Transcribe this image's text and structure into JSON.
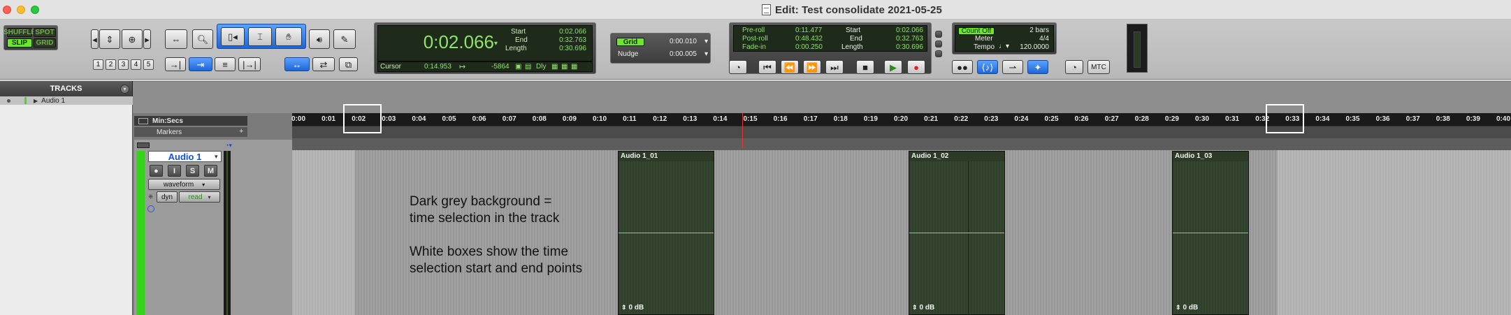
{
  "window": {
    "title": "Edit: Test consolidate 2021-05-25"
  },
  "toolbar": {
    "modes": {
      "shuffle": "SHUFFLE",
      "spot": "SPOT",
      "slip": "SLIP",
      "grid": "GRID"
    },
    "zoom_presets": [
      "1",
      "2",
      "3",
      "4",
      "5"
    ],
    "main_counter": "0:02.066",
    "selection": {
      "start_label": "Start",
      "start": "0:02.066",
      "end_label": "End",
      "end": "0:32.763",
      "length_label": "Length",
      "length": "0:30.696"
    },
    "cursor": {
      "label": "Cursor",
      "time": "0:14.953",
      "sample": "-5864",
      "dly_label": "Dly"
    },
    "grid": {
      "label": "Grid",
      "value": "0:00.010"
    },
    "nudge": {
      "label": "Nudge",
      "value": "0:00.005"
    },
    "transport": {
      "preroll_label": "Pre-roll",
      "preroll": "0:11.477",
      "postroll_label": "Post-roll",
      "postroll": "0:48.432",
      "fadein_label": "Fade-in",
      "fadein": "0:00.250",
      "start_label": "Start",
      "start": "0:02.066",
      "end_label": "End",
      "end": "0:32.763",
      "length_label": "Length",
      "length": "0:30.696"
    },
    "countoff": {
      "label": "Count Off",
      "value": "2 bars",
      "meter_label": "Meter",
      "meter": "4/4",
      "tempo_label": "Tempo",
      "tempo": "120.0000"
    },
    "mtc_label": "MTC"
  },
  "tracks_panel": {
    "title": "TRACKS",
    "items": [
      {
        "name": "Audio 1"
      }
    ]
  },
  "rulers": {
    "minsecs": "Min:Secs",
    "markers": "Markers"
  },
  "timeline_ticks": [
    "0:00",
    "0:01",
    "0:02",
    "0:03",
    "0:04",
    "0:05",
    "0:06",
    "0:07",
    "0:08",
    "0:09",
    "0:10",
    "0:11",
    "0:12",
    "0:13",
    "0:14",
    "0:15",
    "0:16",
    "0:17",
    "0:18",
    "0:19",
    "0:20",
    "0:21",
    "0:22",
    "0:23",
    "0:24",
    "0:25",
    "0:26",
    "0:27",
    "0:28",
    "0:29",
    "0:30",
    "0:31",
    "0:32",
    "0:33",
    "0:34",
    "0:35",
    "0:36",
    "0:37",
    "0:38",
    "0:39",
    "0:40"
  ],
  "track": {
    "name": "Audio 1",
    "buttons": {
      "record": "●",
      "input": "I",
      "solo": "S",
      "mute": "M"
    },
    "view": "waveform",
    "dyn": "dyn",
    "automation": "read"
  },
  "clips": [
    {
      "name": "Audio 1_01",
      "gain": "0 dB"
    },
    {
      "name": "Audio 1_02",
      "gain": "0 dB"
    },
    {
      "name": "Audio 1_03",
      "gain": "0 dB"
    }
  ],
  "annotation": {
    "line1": "Dark grey background =",
    "line2": "time selection in the track",
    "line3": "White boxes show the time",
    "line4": "selection start and end points"
  },
  "colors": {
    "track_green": "#35d31a",
    "counter_green": "#8fe36b",
    "track_name_blue": "#1350e8",
    "cursor_red": "#e23232"
  }
}
